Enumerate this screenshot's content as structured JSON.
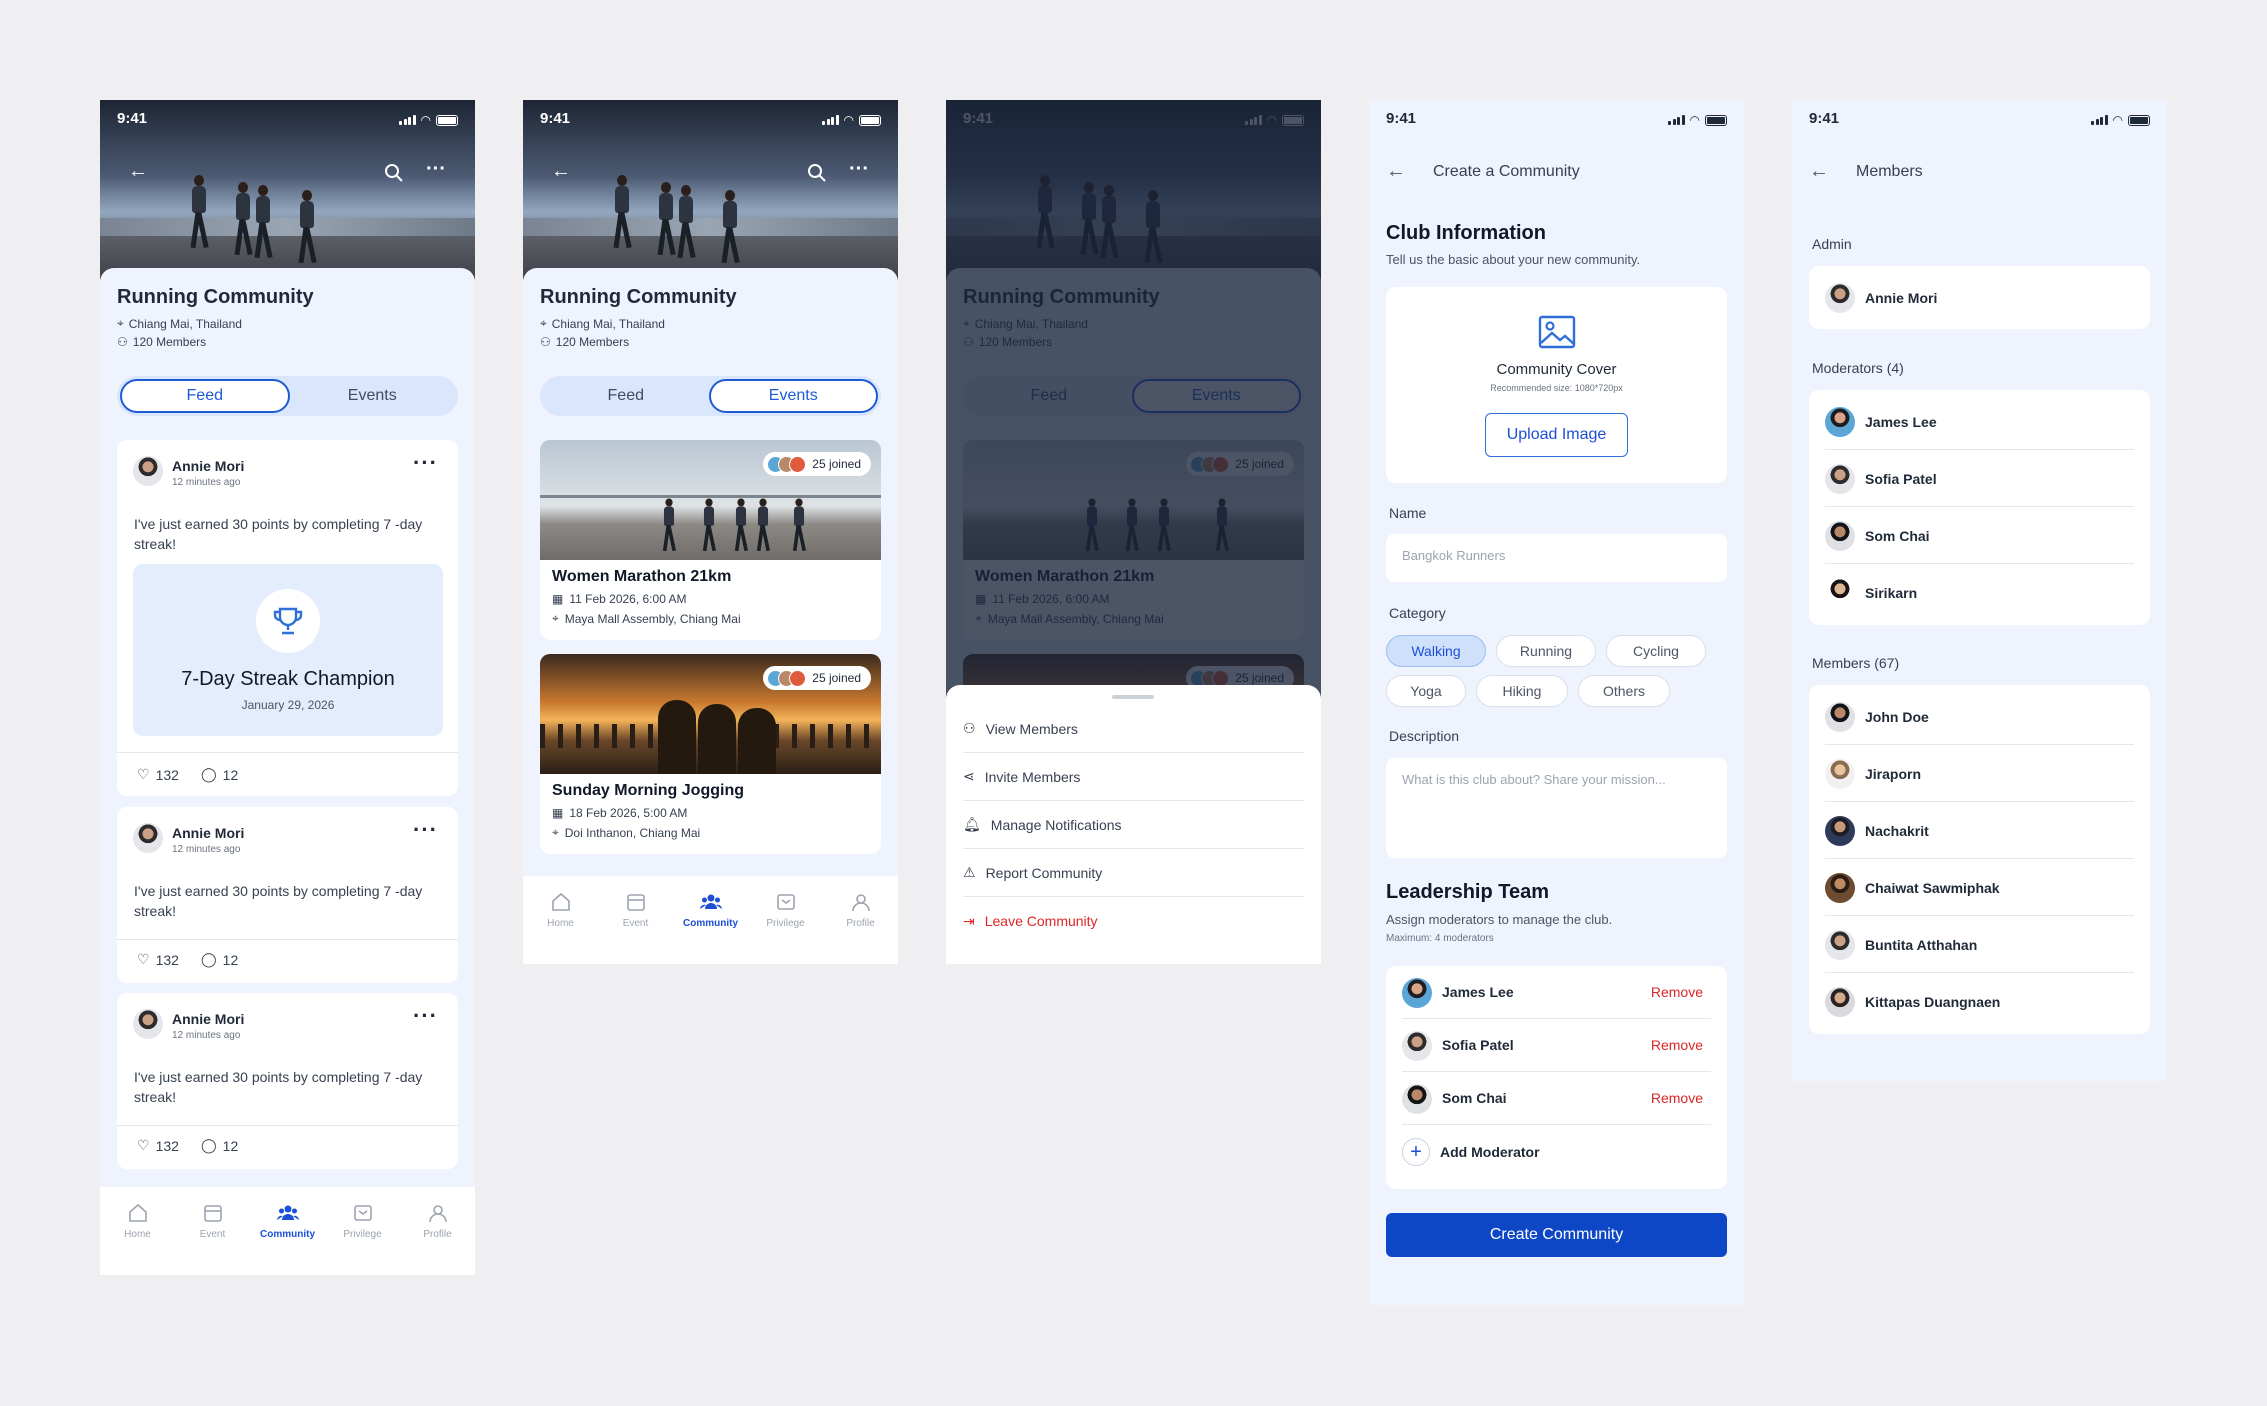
{
  "status_time": "9:41",
  "community": {
    "name": "Running Community",
    "location": "Chiang Mai, Thailand",
    "members": "120 Members"
  },
  "tabs": {
    "feed": "Feed",
    "events": "Events"
  },
  "posts": [
    {
      "author": "Annie Mori",
      "time": "12 minutes ago",
      "text": "I've just earned 30 points by completing 7 -day streak!",
      "likes": "132",
      "comments": "12"
    },
    {
      "author": "Annie Mori",
      "time": "12 minutes ago",
      "text": "I've just earned 30 points by completing 7 -day streak!",
      "likes": "132",
      "comments": "12"
    },
    {
      "author": "Annie Mori",
      "time": "12 minutes ago",
      "text": "I've just earned 30 points by completing 7 -day streak!",
      "likes": "132",
      "comments": "12"
    }
  ],
  "badge": {
    "title": "7-Day Streak Champion",
    "date": "January 29, 2026"
  },
  "events": [
    {
      "title": "Women Marathon 21km",
      "datetime": "11 Feb 2026, 6:00 AM",
      "place": "Maya Mall Assembly, Chiang Mai",
      "joined": "25 joined"
    },
    {
      "title": "Sunday Morning Jogging",
      "datetime": "18 Feb 2026, 5:00 AM",
      "place": "Doi Inthanon, Chiang Mai",
      "joined": "25 joined"
    }
  ],
  "nav": {
    "home": "Home",
    "event": "Event",
    "community": "Community",
    "privilege": "Privilege",
    "profile": "Profile"
  },
  "menu": {
    "view_members": "View Members",
    "invite_members": "Invite Members",
    "manage_notifications": "Manage Notifications",
    "report_community": "Report Community",
    "leave_community": "Leave Community"
  },
  "create": {
    "title": "Create a Community",
    "section": "Club Information",
    "section_sub": "Tell us the basic about your new community.",
    "cover_title": "Community Cover",
    "cover_hint": "Recommended size: 1080*720px",
    "upload": "Upload Image",
    "name_label": "Name",
    "name_placeholder": "Bangkok Runners",
    "category_label": "Category",
    "categories": [
      "Walking",
      "Running",
      "Cycling",
      "Yoga",
      "Hiking",
      "Others"
    ],
    "description_label": "Description",
    "description_placeholder": "What is this club about? Share your mission...",
    "leadership_title": "Leadership Team",
    "leadership_sub": "Assign moderators to manage the club.",
    "leadership_max": "Maximum: 4 moderators",
    "leaders": [
      "James Lee",
      "Sofia Patel",
      "Som Chai"
    ],
    "remove": "Remove",
    "add_moderator": "Add Moderator",
    "submit": "Create Community"
  },
  "members_screen": {
    "title": "Members",
    "admin_label": "Admin",
    "admin": "Annie Mori",
    "moderators_label": "Moderators (4)",
    "moderators": [
      "James Lee",
      "Sofia Patel",
      "Som Chai",
      "Sirikarn"
    ],
    "members_label": "Members (67)",
    "members": [
      "John Doe",
      "Jiraporn",
      "Nachakrit",
      "Chaiwat Sawmiphak",
      "Buntita Atthahan",
      "Kittapas Duangnaen"
    ]
  },
  "colors": {
    "primary": "#1D4FD4",
    "danger": "#DC2626",
    "screen_bg": "#EEF3FD",
    "page_bg": "#EFEFF1"
  }
}
